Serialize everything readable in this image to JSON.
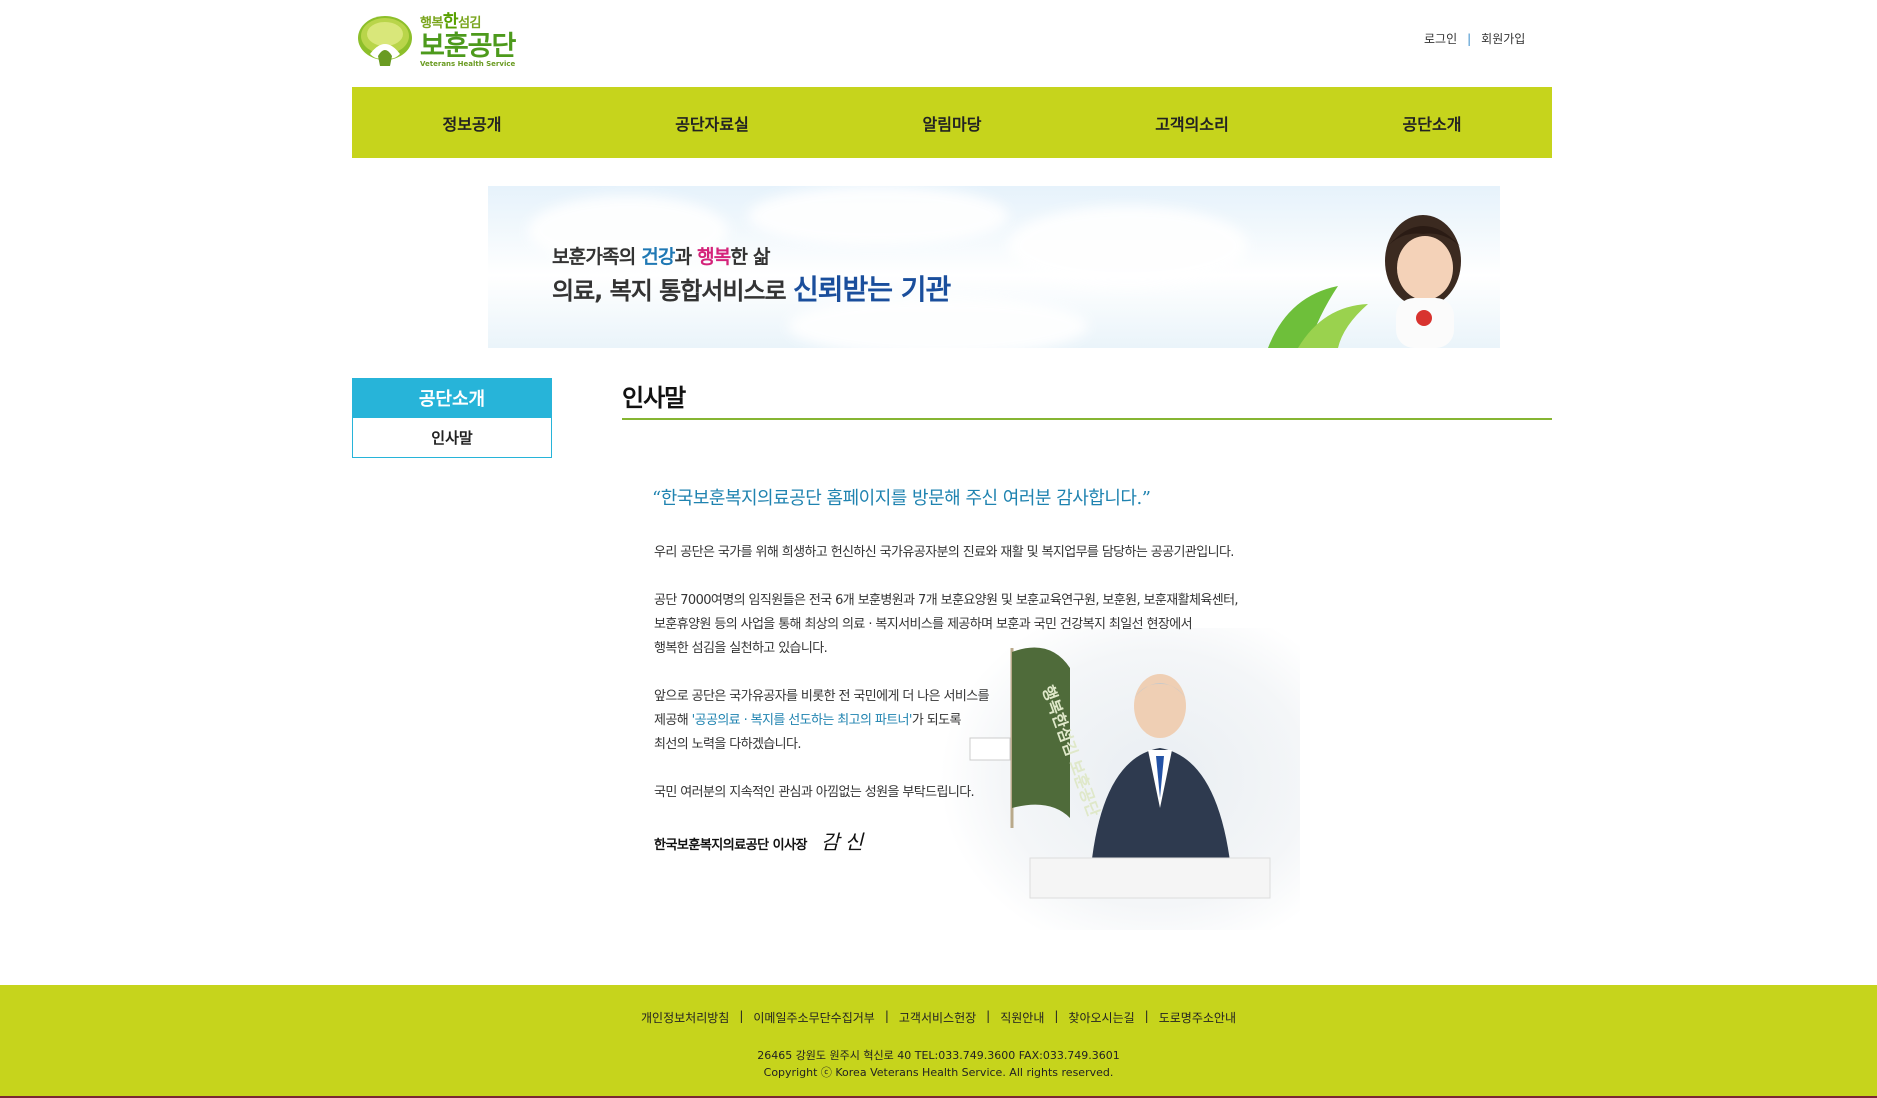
{
  "header": {
    "logo": {
      "tagline_pre": "행복",
      "tagline_em": "한",
      "tagline_post": "섬김",
      "name": "보훈공단",
      "english": "Veterans Health Service"
    },
    "util": {
      "login": "로그인",
      "sep": "|",
      "join": "회원가입"
    }
  },
  "gnb": {
    "items": [
      {
        "label": "정보공개"
      },
      {
        "label": "공단자료실"
      },
      {
        "label": "알림마당"
      },
      {
        "label": "고객의소리"
      },
      {
        "label": "공단소개"
      }
    ]
  },
  "banner": {
    "line1_a": "보훈가족의 ",
    "line1_b": "건강",
    "line1_c": "과 ",
    "line1_d": "행복",
    "line1_e": "한 삶",
    "line2_a": "의료, 복지 통합서비스로 ",
    "line2_b": "신뢰받는 기관"
  },
  "lnb": {
    "title": "공단소개",
    "items": [
      {
        "label": "인사말"
      }
    ]
  },
  "content": {
    "title": "인사말",
    "quote": "“한국보훈복지의료공단 홈페이지를 방문해 주신 여러분 감사합니다.”",
    "p1": "우리 공단은 국가를 위해 희생하고 헌신하신 국가유공자분의 진료와 재활 및 복지업무를 담당하는 공공기관입니다.",
    "p2_l1": "공단 7000여명의 임직원들은 전국 6개 보훈병원과 7개 보훈요양원 및 보훈교육연구원, 보훈원, 보훈재활체육센터,",
    "p2_l2": "보훈휴양원 등의 사업을 통해 최상의 의료 · 복지서비스를 제공하며 보훈과 국민 건강복지 최일선 현장에서",
    "p2_l3": "행복한 섬김을 실천하고 있습니다.",
    "p3_l1": "앞으로 공단은 국가유공자를 비롯한 전 국민에게 더 나은 서비스를",
    "p3_l2_a": "제공해 ",
    "p3_l2_b": "'공공의료 · 복지를 선도하는 최고의 파트너'",
    "p3_l2_c": "가  되도록",
    "p3_l3": "최선의 노력을 다하겠습니다.",
    "p4": "국민 여러분의 지속적인 관심과 아낌없는 성원을 부탁드립니다.",
    "sign": "한국보훈복지의료공단  이사장",
    "signature": "감 신",
    "flag_text": "행복한섬김 보훈공단"
  },
  "footer": {
    "links": [
      {
        "label": "개인정보처리방침"
      },
      {
        "label": "이메일주소무단수집거부"
      },
      {
        "label": "고객서비스헌장"
      },
      {
        "label": "직원안내"
      },
      {
        "label": "찾아오시는길"
      },
      {
        "label": "도로명주소안내"
      }
    ],
    "sep": "|",
    "address": "26465 강원도 원주시 혁신로 40 TEL:033.749.3600 FAX:033.749.3601",
    "copyright": "Copyright ⓒ Korea Veterans Health Service. All rights reserved."
  },
  "colors": {
    "brand_green": "#c6d41c",
    "accent_blue": "#27b4d9",
    "rule_green": "#86b532",
    "text_blue": "#1f83b0"
  }
}
